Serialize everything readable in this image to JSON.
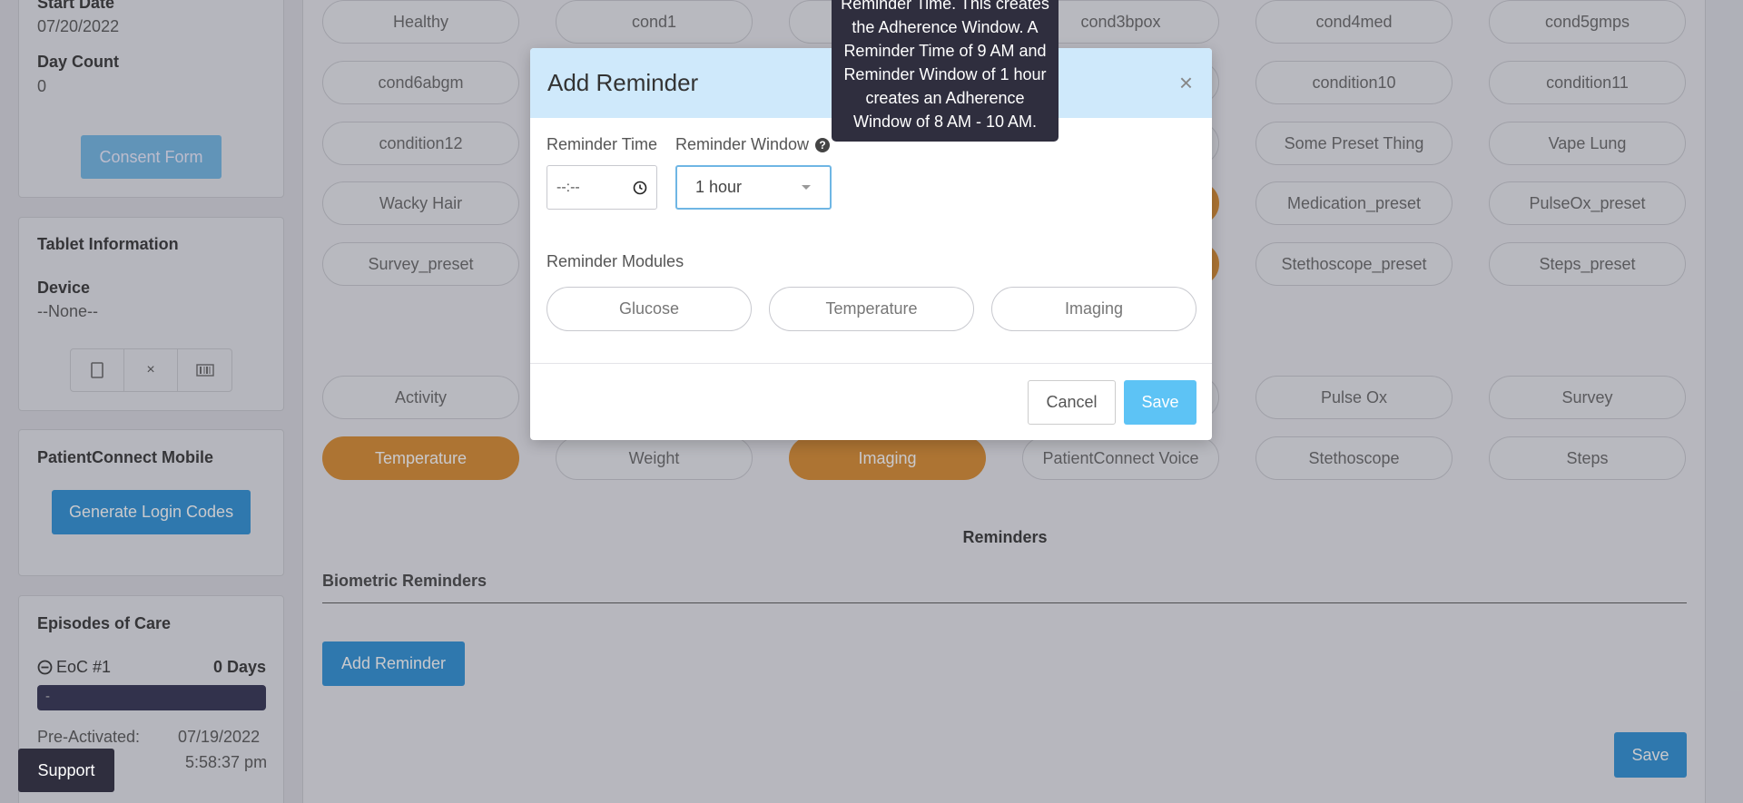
{
  "left": {
    "patient": {
      "start_date_label": "Start Date",
      "start_date": "07/20/2022",
      "day_count_label": "Day Count",
      "day_count": "0",
      "consent_button": "Consent Form"
    },
    "tablet": {
      "title": "Tablet Information",
      "device_label": "Device",
      "device_value": "--None--",
      "buttons": [
        "tablet-icon",
        "close-icon",
        "barcode-icon"
      ]
    },
    "mobile": {
      "title": "PatientConnect Mobile",
      "generate_button": "Generate Login Codes"
    },
    "episodes": {
      "title": "Episodes of Care",
      "eoc_label": "EoC #1",
      "eoc_days": "0 Days",
      "bar_text": "-",
      "pre_activated_label": "Pre-Activated:",
      "pre_activated_date": "07/19/2022",
      "pre_activated_time": "5:58:37 pm"
    },
    "support_button": "Support"
  },
  "presets": [
    [
      "Healthy",
      "cond1",
      "",
      "cond3bpox",
      "cond4med",
      "cond5gmps"
    ],
    [
      "cond6abgm",
      "",
      "",
      "",
      "condition10",
      "condition11"
    ],
    [
      "condition12",
      "",
      "",
      "",
      "Some Preset Thing",
      "Vape Lung"
    ],
    [
      "Wacky Hair",
      "",
      "",
      "",
      "Medication_preset",
      "PulseOx_preset"
    ],
    [
      "Survey_preset",
      "",
      "",
      "",
      "Stethoscope_preset",
      "Steps_preset"
    ]
  ],
  "modules": [
    [
      "Activity",
      "",
      "",
      "",
      "Pulse Ox",
      "Survey"
    ],
    [
      "Temperature",
      "Weight",
      "Imaging",
      "PatientConnect Voice",
      "Stethoscope",
      "Steps"
    ]
  ],
  "reminders": {
    "title": "Reminders",
    "biometric_label": "Biometric Reminders",
    "add_button": "Add Reminder",
    "save_button": "Save"
  },
  "modal": {
    "title": "Add Reminder",
    "close": "×",
    "time_label": "Reminder Time",
    "time_value": "--:--",
    "window_label": "Reminder Window",
    "window_value": "1 hour",
    "modules_label": "Reminder Modules",
    "module_options": [
      "Glucose",
      "Temperature",
      "Imaging"
    ],
    "cancel": "Cancel",
    "save": "Save"
  },
  "tooltip": {
    "text": "Reminder Time. This creates the Adherence Window. A Reminder Time of 9 AM and Reminder Window of 1 hour creates an Adherence Window of 8 AM - 10 AM."
  },
  "colors": {
    "accent_blue": "#2a8fd6",
    "active_orange": "#d98a2c",
    "modal_header": "#cfe9fb"
  }
}
